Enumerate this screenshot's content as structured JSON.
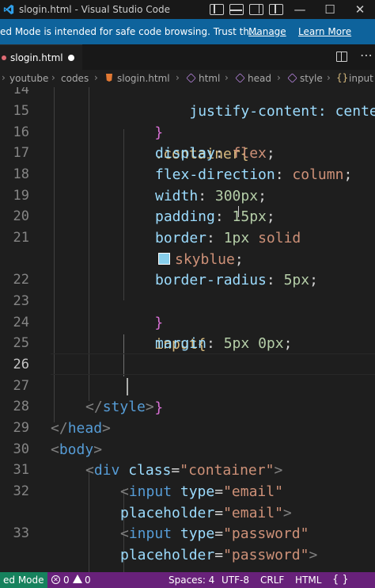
{
  "titlebar": {
    "title": "slogin.html - Visual Studio Code",
    "minimize": "—",
    "maximize": "☐",
    "close": "✕"
  },
  "restricted_banner": {
    "message": "ed Mode is intended for safe code browsing. Trust th...",
    "manage": "Manage",
    "learn_more": "Learn More"
  },
  "tabs": [
    {
      "label": "slogin.html",
      "modified": true
    }
  ],
  "breadcrumb": {
    "items": [
      "youtube",
      "codes",
      "slogin.html",
      "html",
      "head",
      "style",
      "input"
    ]
  },
  "editor": {
    "lines": [
      {
        "num": "14",
        "code": "justify-content: center;"
      },
      {
        "num": "15",
        "code": "}"
      },
      {
        "num": "16",
        "code": ".container{"
      },
      {
        "num": "17",
        "prop": "display",
        "val": "flex"
      },
      {
        "num": "18",
        "prop": "flex-direction",
        "val": "column"
      },
      {
        "num": "19",
        "prop": "width",
        "val": "300px"
      },
      {
        "num": "20",
        "prop": "padding",
        "val": "15px"
      },
      {
        "num": "21",
        "prop": "border",
        "val1": "1px",
        "val2": "solid",
        "val3": "skyblue"
      },
      {
        "num": "22",
        "prop": "border-radius",
        "val": "5px"
      },
      {
        "num": "23",
        "code": "}"
      },
      {
        "num": "24",
        "code": "input{"
      },
      {
        "num": "25",
        "prop": "margin",
        "val1": "5px",
        "val2": "0px"
      },
      {
        "num": "26",
        "code": ""
      },
      {
        "num": "27",
        "code": "}"
      },
      {
        "num": "28",
        "tag": "style",
        "closing": true
      },
      {
        "num": "29",
        "tag": "head",
        "closing": true
      },
      {
        "num": "30",
        "tag": "body"
      },
      {
        "num": "31",
        "tag": "div",
        "attr": "class",
        "value": "\"container\""
      },
      {
        "num": "32",
        "tag": "input",
        "attr": "type",
        "value": "\"email\"",
        "attr2": "placeholder",
        "value2": "\"email\""
      },
      {
        "num": "33",
        "tag": "input",
        "attr": "type",
        "value": "\"password\"",
        "attr2": "placeholder",
        "value2": "\"password\""
      }
    ]
  },
  "statusbar": {
    "mode": "ed Mode",
    "errors": "0",
    "warnings": "0",
    "spaces": "Spaces: 4",
    "encoding": "UTF-8",
    "eol": "CRLF",
    "language": "HTML",
    "colors": {
      "background": "#68217a",
      "restricted": "#16825d"
    }
  },
  "icons": {
    "app": "vscode-icon",
    "layout_toggles": [
      "toggle-sidebar-icon",
      "toggle-panel-icon",
      "toggle-secondary-sidebar-icon",
      "customize-layout-icon"
    ],
    "split": "split-editor-icon",
    "more": "more-actions-icon"
  }
}
